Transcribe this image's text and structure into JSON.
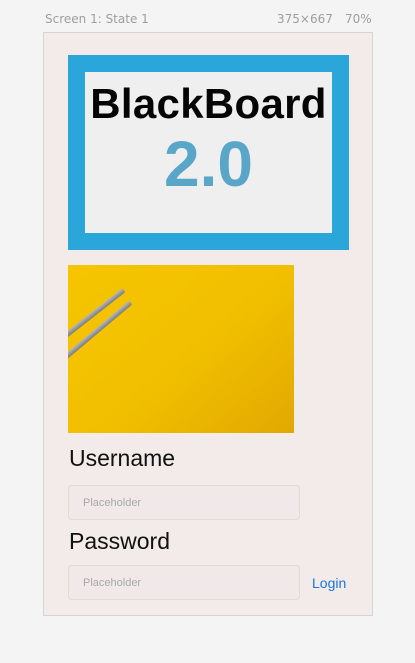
{
  "toolbar": {
    "screen_label": "Screen 1: State 1",
    "size_label": "375×667",
    "zoom_label": "70%"
  },
  "logo": {
    "title": "BlackBoard",
    "version": "2.0",
    "frame_color": "#2aa6db",
    "version_color": "#5aa6c9"
  },
  "image": {
    "description_icon": "pencils-on-yellow-photo"
  },
  "form": {
    "username_label": "Username",
    "username_placeholder": "Placeholder",
    "username_value": "",
    "password_label": "Password",
    "password_placeholder": "Placeholder",
    "password_value": "",
    "login_label": "Login",
    "link_color": "#1677e3"
  }
}
